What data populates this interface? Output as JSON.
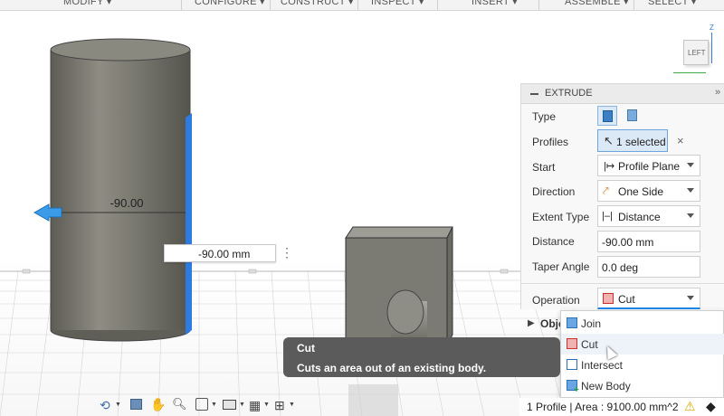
{
  "toolbar": {
    "items": [
      "MODIFY ▾",
      "CONFIGURE ▾",
      "CONSTRUCT ▾",
      "INSPECT ▾",
      "INSERT ▾",
      "ASSEMBLE ▾",
      "SELECT ▾"
    ]
  },
  "viewcube": {
    "face_label": "LEFT",
    "axis_label": "Z"
  },
  "viewport": {
    "dimension_label": "-90.00",
    "distance_input_value": "-90.00 mm"
  },
  "panel": {
    "title": "EXTRUDE",
    "type_label": "Type",
    "profiles_label": "Profiles",
    "profiles_value": "1 selected",
    "profiles_clear": "×",
    "start_label": "Start",
    "start_value": "Profile Plane",
    "direction_label": "Direction",
    "direction_value": "One Side",
    "extent_label": "Extent Type",
    "extent_value": "Distance",
    "distance_label": "Distance",
    "distance_value": "-90.00 mm",
    "taper_label": "Taper Angle",
    "taper_value": "0.0 deg",
    "operation_label": "Operation",
    "operation_value": "Cut",
    "objects_label": "Obje"
  },
  "dropdown": {
    "items": [
      {
        "label": "Join",
        "color": "#3d7fc4"
      },
      {
        "label": "Cut",
        "color": "#d9534f"
      },
      {
        "label": "Intersect",
        "color": "#3d7fc4"
      },
      {
        "label": "New Body",
        "color": "#3d7fc4"
      }
    ]
  },
  "tooltip": {
    "title": "Cut",
    "description": "Cuts an area out of an existing body."
  },
  "status": {
    "text": "1 Profile | Area : 9100.00 mm^2"
  },
  "colors": {
    "accent": "#1e88e5",
    "body_gray": "#75746c",
    "panel_bg": "#f8f8f8"
  }
}
